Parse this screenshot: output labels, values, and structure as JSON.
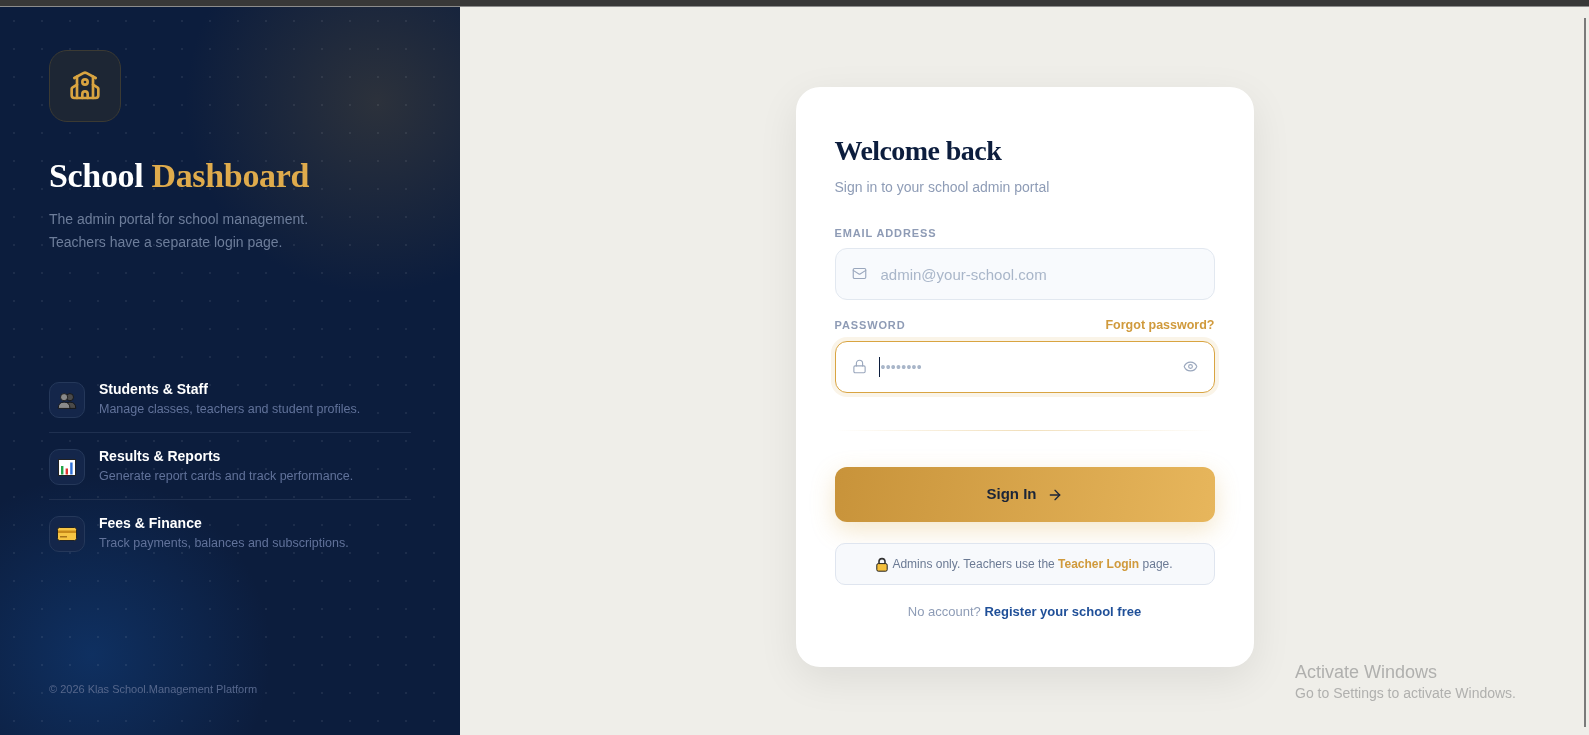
{
  "sidebar": {
    "title": "School",
    "title_accent": "Dashboard",
    "description": "The admin portal for school management. Teachers have a separate login page.",
    "features": [
      {
        "title": "Students & Staff",
        "description": "Manage classes, teachers and student profiles."
      },
      {
        "title": "Results & Reports",
        "description": "Generate report cards and track performance."
      },
      {
        "title": "Fees & Finance",
        "description": "Track payments, balances and subscriptions."
      }
    ],
    "footer": "© 2026 Klas School.Management Platform"
  },
  "login_card": {
    "heading": "Welcome back",
    "subheading": "Sign in to your school admin portal",
    "email": {
      "label": "EMAIL ADDRESS",
      "placeholder": "admin@your-school.com",
      "focused": false
    },
    "password": {
      "label": "PASSWORD",
      "placeholder": "••••••••",
      "focused": true,
      "forgot_link": "Forgot password?"
    },
    "submit": "Sign In",
    "notice": {
      "text_before": "Admins only. Teachers use the",
      "link": "Teacher Login",
      "text_after": "page."
    },
    "register": {
      "prompt": "No account?",
      "link": "Register your school free"
    }
  },
  "system_notice": {
    "title": "Activate Windows",
    "text": "Go to Settings to activate Windows."
  }
}
